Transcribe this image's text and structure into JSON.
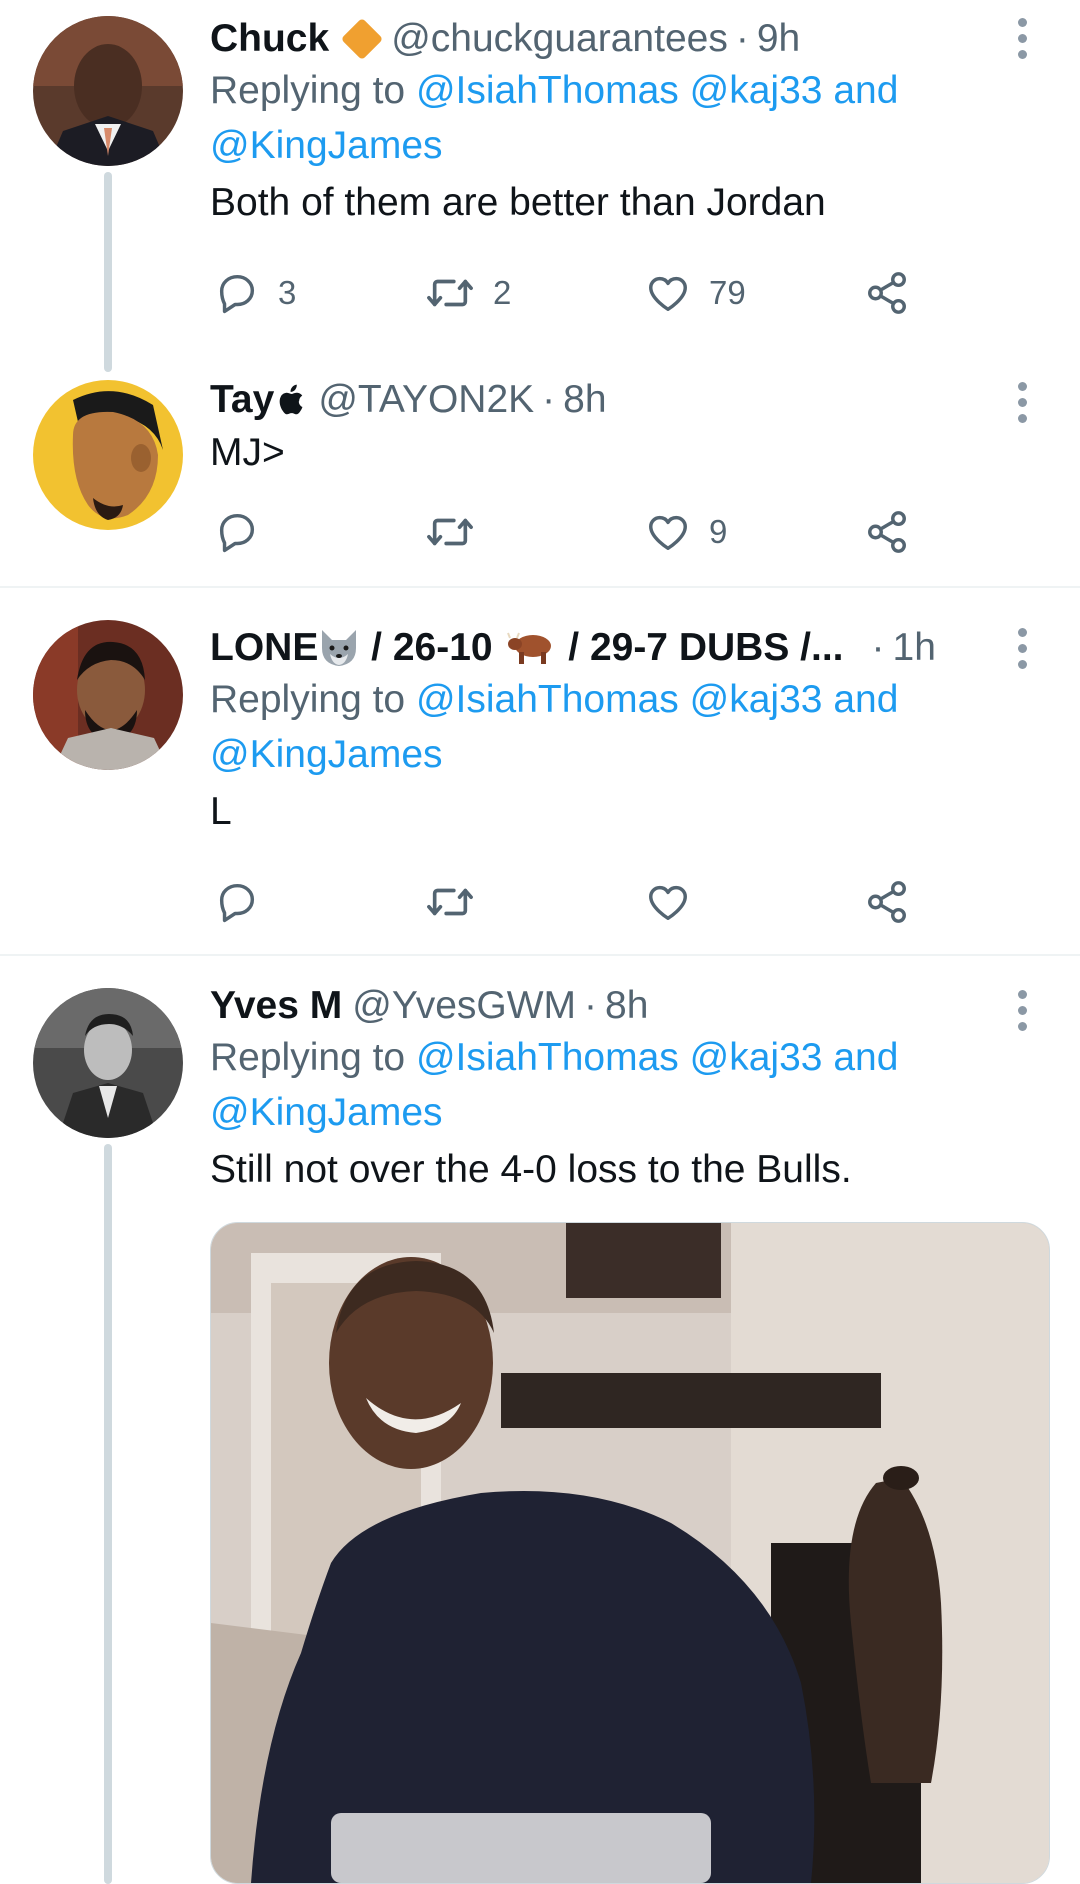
{
  "tweets": [
    {
      "display_name": "Chuck",
      "badge": "orange-diamond",
      "handle": "@chuckguarantees",
      "separator": "·",
      "time": "9h",
      "replying_prefix": "Replying to ",
      "mentions": [
        "@IsiahThomas",
        "@kaj33",
        "and",
        "@KingJames"
      ],
      "text": "Both of them are better than Jordan",
      "replies": "3",
      "retweets": "2",
      "likes": "79"
    },
    {
      "display_name": "Tay",
      "badge": "apple-icon",
      "handle": "@TAYON2K",
      "separator": "·",
      "time": "8h",
      "text": "MJ>",
      "replies": "",
      "retweets": "",
      "likes": "9"
    },
    {
      "display_name_part1": "LONE",
      "display_name_part2": " / 26-10 ",
      "display_name_part3": " / 29-7 DUBS /...",
      "badge_icons": [
        "wolf-emoji",
        "ox-emoji"
      ],
      "separator": "·",
      "time": "1h",
      "replying_prefix": "Replying to ",
      "mentions": [
        "@IsiahThomas",
        "@kaj33",
        "and",
        "@KingJames"
      ],
      "text": "L",
      "replies": "",
      "retweets": "",
      "likes": ""
    },
    {
      "display_name": "Yves M",
      "handle": "@YvesGWM",
      "separator": "·",
      "time": "8h",
      "replying_prefix": "Replying to ",
      "mentions": [
        "@IsiahThomas",
        "@kaj33",
        "and",
        "@KingJames"
      ],
      "text": "Still not over the 4-0 loss to the Bulls."
    }
  ],
  "colors": {
    "mention": "#1d9bf0",
    "secondary_text": "#536471",
    "primary_text": "#0f1419",
    "badge_diamond": "#f0a030"
  },
  "icons": [
    "reply-icon",
    "retweet-icon",
    "like-icon",
    "share-icon",
    "more-icon"
  ]
}
